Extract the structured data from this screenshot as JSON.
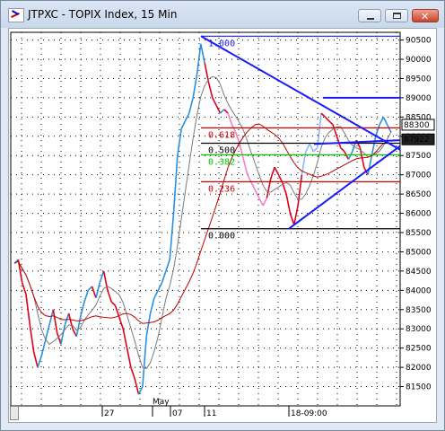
{
  "window": {
    "title": "JTPXC - TOPIX Index, 15 Min"
  },
  "chart_data": {
    "type": "line",
    "title": "JTPXC - TOPIX Index, 15 Min",
    "ylim": [
      8100,
      9070
    ],
    "y_ticks": [
      8150,
      8200,
      8250,
      8300,
      8350,
      8400,
      8450,
      8500,
      8550,
      8600,
      8650,
      8700,
      8750,
      8800,
      8850,
      8900,
      8950,
      9000,
      9050
    ],
    "y_tick_labels": [
      "81500",
      "82000",
      "82500",
      "83000",
      "83500",
      "84000",
      "84500",
      "85000",
      "85500",
      "86000",
      "86500",
      "87000",
      "87500",
      "88000",
      "88500",
      "89000",
      "89500",
      "90000",
      "90500"
    ],
    "x_tick_labels": [
      "27",
      "May",
      "07",
      "11",
      "18-09:00"
    ],
    "price_labels": [
      {
        "text": "88300",
        "value": 8830,
        "bg": "#ffffff"
      },
      {
        "text": "87922",
        "value": 8792,
        "bg": "#222222"
      }
    ],
    "fibonacci": [
      {
        "label": "1.000",
        "value": 9060,
        "color": "#1a1aff"
      },
      {
        "label": "0.618",
        "value": 8822,
        "color": "#cc0000"
      },
      {
        "label": "0.500",
        "value": 8782,
        "color": "#000000"
      },
      {
        "label": "0.382",
        "value": 8752,
        "color": "#00cc00"
      },
      {
        "label": "0.236",
        "value": 8682,
        "color": "#cc0000"
      },
      {
        "label": "0.000",
        "value": 8560,
        "color": "#000000"
      }
    ],
    "price_series": [
      8470,
      8480,
      8420,
      8390,
      8310,
      8240,
      8200,
      8230,
      8270,
      8310,
      8350,
      8290,
      8260,
      8310,
      8340,
      8300,
      8280,
      8330,
      8370,
      8400,
      8410,
      8380,
      8420,
      8450,
      8400,
      8370,
      8360,
      8330,
      8300,
      8250,
      8200,
      8170,
      8130,
      8150,
      8280,
      8340,
      8380,
      8400,
      8420,
      8450,
      8480,
      8600,
      8750,
      8820,
      8840,
      8860,
      8900,
      8960,
      9040,
      8990,
      8940,
      8900,
      8880,
      8860,
      8870,
      8860,
      8830,
      8810,
      8780,
      8740,
      8700,
      8680,
      8660,
      8640,
      8620,
      8640,
      8690,
      8720,
      8700,
      8680,
      8650,
      8600,
      8570,
      8620,
      8700,
      8760,
      8780,
      8760,
      8770,
      8860,
      8850,
      8840,
      8830,
      8800,
      8770,
      8760,
      8740,
      8760,
      8790,
      8770,
      8720,
      8700,
      8750,
      8800,
      8830,
      8850,
      8830,
      8810
    ],
    "series_colors": {
      "price_up": "#2a8fe0",
      "price_down": "#e0001a",
      "price_neutral": "#000000",
      "pink": "#f07fc8",
      "light_blue": "#8ab8ff",
      "ma_fast": "#7a7a7a",
      "ma_slow": "#c00000",
      "trendline": "#1a1aff",
      "price_right": "#2a8fe0"
    },
    "grid": true
  }
}
